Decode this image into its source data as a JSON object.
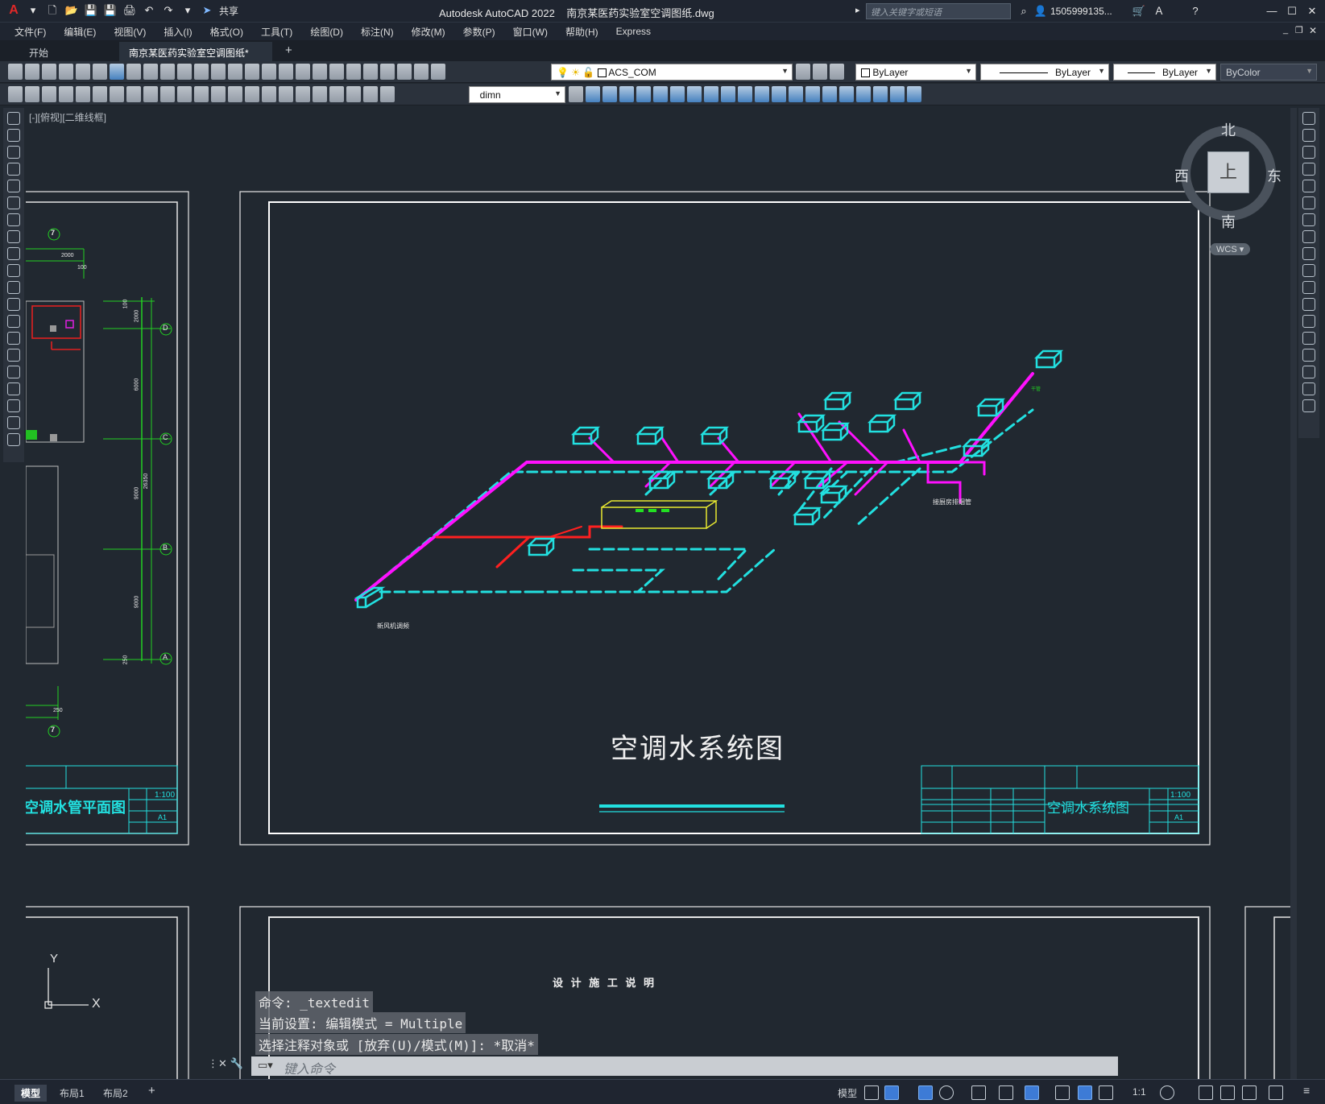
{
  "app": {
    "title": "Autodesk AutoCAD 2022",
    "document": "南京某医药实验室空调图纸.dwg",
    "share_label": "共享",
    "search_placeholder": "键入关键字或短语",
    "user": "1505999135...",
    "logo": "A"
  },
  "menu": [
    "文件(F)",
    "编辑(E)",
    "视图(V)",
    "插入(I)",
    "格式(O)",
    "工具(T)",
    "绘图(D)",
    "标注(N)",
    "修改(M)",
    "参数(P)",
    "窗口(W)",
    "帮助(H)",
    "Express"
  ],
  "tabs": [
    {
      "label": "开始"
    },
    {
      "label": "南京某医药实验室空调图纸*"
    }
  ],
  "toolbar": {
    "layer": "ACS_COM",
    "color": "ByLayer",
    "linetype": "ByLayer",
    "lineweight": "ByLayer",
    "plotstyle": "ByColor",
    "dimstyle": "dimn"
  },
  "canvas": {
    "view_label": "[-][俯视][二维线框]",
    "viewcube": {
      "top": "上",
      "north": "北",
      "south": "南",
      "west": "西",
      "east": "东",
      "wcs": "WCS"
    },
    "ucs": {
      "x": "X",
      "y": "Y"
    },
    "drawing": {
      "main_title": "空调水系统图",
      "left_title": "空调水管平面图",
      "tb_scale": "1:100",
      "tb_sheet": "A1",
      "design_note": "设 计 施 工 说 明",
      "axis_labels": [
        "7",
        "D",
        "C",
        "B",
        "A",
        "7"
      ],
      "dims": [
        "2000",
        "100",
        "100",
        "2000",
        "6000",
        "9000",
        "26350",
        "9000",
        "250",
        "250"
      ],
      "pipe_labels": [
        "新风机调频",
        "接厨房排烟管",
        "干管"
      ]
    }
  },
  "command": {
    "history": [
      "命令: _textedit",
      "当前设置: 编辑模式 = Multiple",
      "选择注释对象或 [放弃(U)/模式(M)]: *取消*"
    ],
    "placeholder": "键入命令"
  },
  "layouts": [
    "模型",
    "布局1",
    "布局2"
  ],
  "status": {
    "model": "模型",
    "scale": "1:1"
  }
}
